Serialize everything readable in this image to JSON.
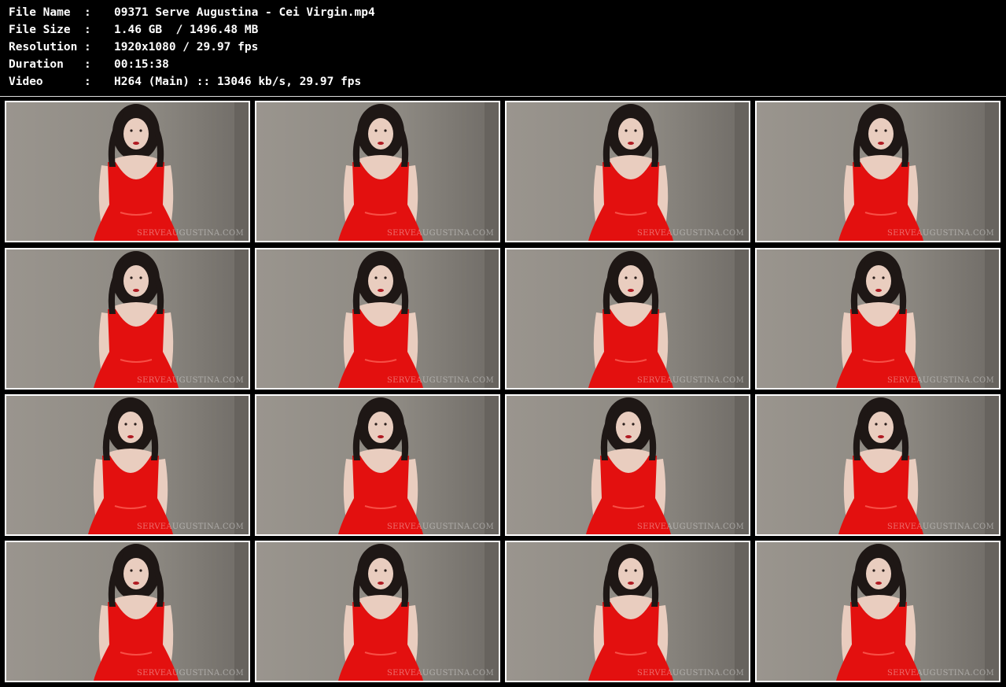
{
  "meta": {
    "rows": [
      {
        "label": "File Name  :",
        "value": "09371 Serve Augustina - Cei Virgin.mp4"
      },
      {
        "label": "File Size  :",
        "value": "1.46 GB  / 1496.48 MB"
      },
      {
        "label": "Resolution :",
        "value": "1920x1080 / 29.97 fps"
      },
      {
        "label": "Duration   :",
        "value": "00:15:38"
      },
      {
        "label": "Video      :",
        "value": "H264 (Main) :: 13046 kb/s, 29.97 fps"
      }
    ]
  },
  "watermark": "SERVEAUGUSTINA.COM",
  "colors": {
    "background": "#000000",
    "text": "#ffffff",
    "frame_border": "#ffffff",
    "wall": "#8d8982",
    "dress": "#e3100f",
    "hair": "#1e1715",
    "skin": "#e9cdbf"
  }
}
